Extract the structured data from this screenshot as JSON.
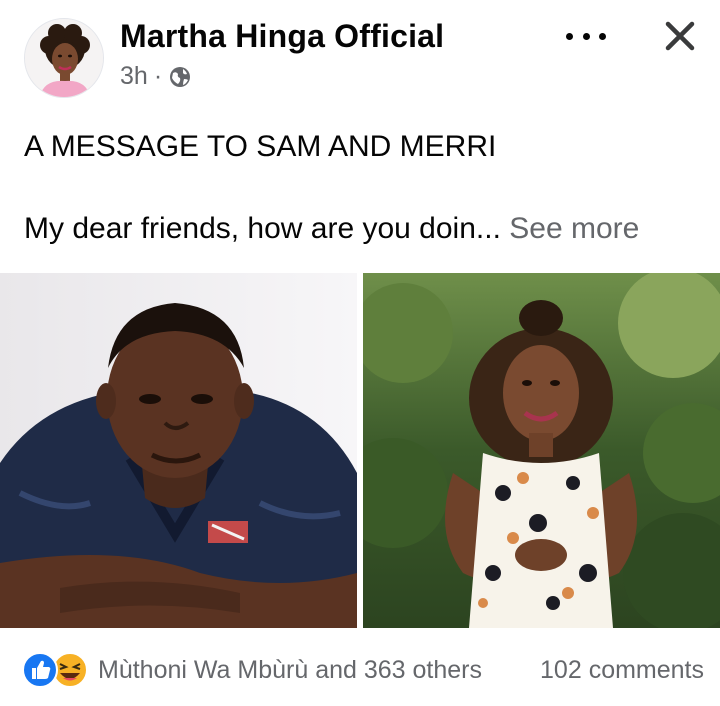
{
  "post": {
    "author": "Martha Hinga Official",
    "time": "3h",
    "separator": "·",
    "privacy_icon": "globe-icon",
    "headline": "A MESSAGE TO SAM AND MERRI",
    "body_preview": "My dear friends, how are you doin...",
    "see_more": "See more"
  },
  "photos": [
    {
      "icon": "photo-man"
    },
    {
      "icon": "photo-woman"
    }
  ],
  "footer": {
    "reaction_icons": [
      "like-icon",
      "haha-icon"
    ],
    "reactors": "Mùthoni Wa Mbùrù and 363 others",
    "comments": "102 comments"
  },
  "colors": {
    "text": "#050505",
    "secondary": "#65676b",
    "like_blue": "#1877f2",
    "haha_yellow": "#f7b125"
  }
}
